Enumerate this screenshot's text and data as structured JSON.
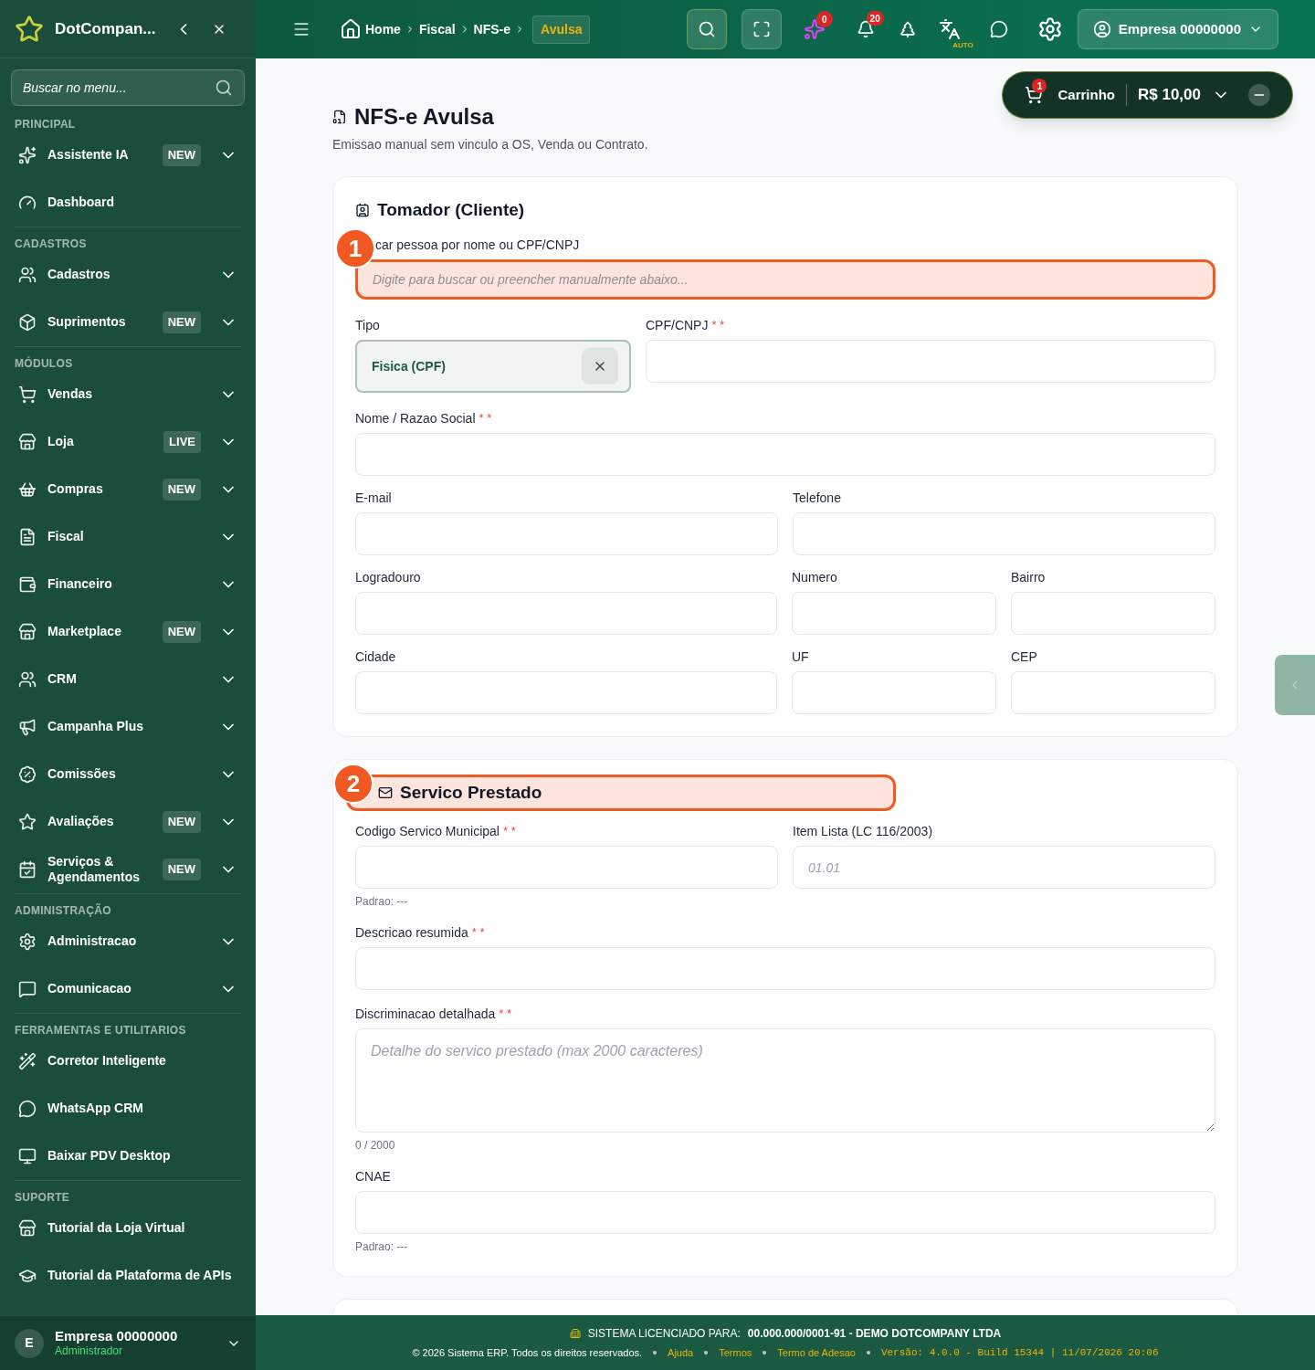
{
  "brand": {
    "name": "DotCompan..."
  },
  "sidebar": {
    "search": {
      "placeholder": "Buscar no menu..."
    },
    "sections": [
      {
        "title": "PRINCIPAL",
        "items": [
          {
            "label": "Assistente IA",
            "badge": "NEW",
            "expanded": false
          },
          {
            "label": "Dashboard"
          }
        ]
      },
      {
        "title": "CADASTROS",
        "items": [
          {
            "label": "Cadastros",
            "expanded": false
          },
          {
            "label": "Suprimentos",
            "badge": "NEW",
            "expanded": false
          }
        ]
      },
      {
        "title": "MÓDULOS",
        "items": [
          {
            "label": "Vendas",
            "expanded": false
          },
          {
            "label": "Loja",
            "badge": "LIVE",
            "expanded": false
          },
          {
            "label": "Compras",
            "badge": "NEW",
            "expanded": false
          },
          {
            "label": "Fiscal",
            "expanded": false
          },
          {
            "label": "Financeiro",
            "expanded": false
          },
          {
            "label": "Marketplace",
            "badge": "NEW",
            "expanded": false
          },
          {
            "label": "CRM",
            "expanded": false
          },
          {
            "label": "Campanha Plus",
            "expanded": false
          },
          {
            "label": "Comissões",
            "expanded": false
          },
          {
            "label": "Avaliações",
            "badge": "NEW",
            "expanded": false
          },
          {
            "label": "Serviços & Agendamentos",
            "badge": "NEW",
            "expanded": false
          }
        ]
      },
      {
        "title": "ADMINISTRAÇÃO",
        "items": [
          {
            "label": "Administracao",
            "expanded": false
          },
          {
            "label": "Comunicacao",
            "expanded": false
          }
        ]
      },
      {
        "title": "FERRAMENTAS E UTILITARIOS",
        "items": [
          {
            "label": "Corretor Inteligente"
          },
          {
            "label": "WhatsApp CRM"
          },
          {
            "label": "Baixar PDV Desktop"
          }
        ]
      },
      {
        "title": "SUPORTE",
        "items": [
          {
            "label": "Tutorial da Loja Virtual"
          },
          {
            "label": "Tutorial da Plataforma de APIs"
          }
        ]
      }
    ],
    "user": {
      "initial": "E",
      "name": "Empresa 00000000",
      "role": "Administrador"
    }
  },
  "header": {
    "breadcrumb": [
      {
        "label": "Home",
        "current": false
      },
      {
        "label": "Fiscal",
        "current": false
      },
      {
        "label": "NFS-e",
        "current": false
      },
      {
        "label": "Avulsa",
        "current": true
      }
    ],
    "ai_count": "0",
    "notification_count": "20",
    "translate_label": "AUTO",
    "account": "Empresa 00000000"
  },
  "cart": {
    "count": "1",
    "label": "Carrinho",
    "total": "R$ 10,00"
  },
  "page": {
    "title": "NFS-e Avulsa",
    "subtitle": "Emissao manual sem vinculo a OS, Venda ou Contrato."
  },
  "tomador": {
    "title": "Tomador (Cliente)",
    "search_label": "car pessoa por nome ou CPF/CNPJ",
    "search_placeholder": "Digite para buscar ou preencher manualmente abaixo...",
    "highlight_badge": "1",
    "tipo": {
      "label": "Tipo",
      "value": "Fisica (CPF)"
    },
    "rows": [
      [
        {
          "label": "CPF/CNPJ",
          "required_mark": "* *"
        }
      ],
      [
        {
          "label": "Nome / Razao Social",
          "required_mark": "* *"
        }
      ],
      [
        {
          "label": "E-mail"
        },
        {
          "label": "Telefone"
        }
      ],
      [
        {
          "label": "Logradouro"
        },
        {
          "label": "Numero"
        },
        {
          "label": "Bairro"
        }
      ],
      [
        {
          "label": "Cidade"
        },
        {
          "label": "UF"
        },
        {
          "label": "CEP"
        }
      ]
    ]
  },
  "servico": {
    "title": "Servico Prestado",
    "highlight_badge": "2",
    "codigo": {
      "label": "Codigo Servico Municipal",
      "required_mark": "* *",
      "hint": "Padrao: ---"
    },
    "item_lista": {
      "label": "Item Lista (LC 116/2003)",
      "placeholder": "01.01"
    },
    "descricao": {
      "label": "Descricao resumida",
      "required_mark": "* *"
    },
    "discriminacao": {
      "label": "Discriminacao detalhada",
      "required_mark": "* *",
      "placeholder": "Detalhe do servico prestado (max 2000 caracteres)",
      "counter": "0 / 2000"
    },
    "cnae": {
      "label": "CNAE",
      "hint": "Padrao: ---"
    }
  },
  "footer": {
    "license_label": "SISTEMA LICENCIADO PARA:",
    "license_value": "00.000.000/0001-91 - DEMO DOTCOMPANY LTDA",
    "copyright": "© 2026 Sistema ERP. Todos os direitos reservados.",
    "links": [
      "Ajuda",
      "Termos",
      "Termo de Adesao"
    ],
    "version": "Versão: 4.0.0 - Build 15344 | 11/07/2026 20:06"
  }
}
